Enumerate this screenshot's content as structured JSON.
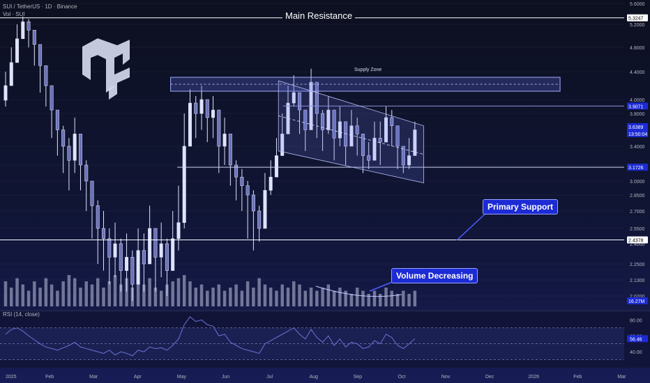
{
  "header": {
    "symbol_line": "SUI / TetherUS · 1D · Binance",
    "volume_line": "Vol · SUI",
    "rsi_title": "RSI (14, close)"
  },
  "annotations": {
    "main_resistance": "Main Resistance",
    "supply_zone": "Supply Zone",
    "primary_support": "Primary Support",
    "volume_decreasing": "Volume Decreasing"
  },
  "colors": {
    "candle": "#dfe3ff",
    "volume": "#bfc4dc",
    "rsi_line": "#6b74d6",
    "accent": "#1c2bd4",
    "level_line": "#ffffff"
  },
  "logo": {
    "icon": "tc-logo-icon"
  },
  "chart_data": [
    {
      "type": "candlestick",
      "title": "SUI / TetherUS · 1D · Binance",
      "y_ticks": [
        "5.6000",
        "5.2000",
        "4.8000",
        "4.4000",
        "4.0000",
        "3.8000",
        "3.4000",
        "3.2000",
        "3.0000",
        "2.8500",
        "2.7000",
        "2.5500",
        "2.4000",
        "2.2500",
        "2.1300",
        "2.0200"
      ],
      "x_ticks": [
        "2025",
        "Feb",
        "Mar",
        "Apr",
        "May",
        "Jun",
        "Jul",
        "Aug",
        "Sep",
        "Oct",
        "Nov",
        "Dec",
        "2026",
        "Feb",
        "Mar"
      ],
      "ylim": [
        2.0,
        5.6
      ],
      "price_labels": [
        {
          "value": "5.3247",
          "price": 5.3247,
          "style": "white"
        },
        {
          "value": "3.9071",
          "price": 3.9071,
          "style": "accent"
        },
        {
          "value": "3.6389",
          "price": 3.6389,
          "style": "accent",
          "sub": "13:50:04"
        },
        {
          "value": "3.1726",
          "price": 3.1726,
          "style": "accent"
        },
        {
          "value": "2.4378",
          "price": 2.4378,
          "style": "white"
        },
        {
          "value": "16.27M",
          "price": 2.0,
          "style": "accent"
        }
      ],
      "levels": {
        "main_resistance": 5.3247,
        "resistance": 3.9071,
        "support": 3.1726,
        "primary_support": 2.4378
      },
      "supply_zone": {
        "low": 4.12,
        "high": 4.32
      },
      "channel": {
        "start_month": 6.2,
        "end_month": 9.5,
        "upper": [
          4.27,
          3.65
        ],
        "lower": [
          3.35,
          2.98
        ]
      },
      "closes": [
        4.2,
        4.55,
        4.95,
        5.25,
        5.1,
        4.85,
        4.5,
        4.2,
        3.85,
        3.6,
        3.4,
        3.25,
        3.55,
        3.2,
        3.0,
        2.75,
        2.55,
        2.45,
        2.3,
        2.4,
        2.2,
        2.3,
        2.1,
        2.35,
        2.25,
        2.55,
        2.3,
        2.4,
        2.2,
        2.45,
        2.6,
        3.4,
        3.95,
        3.8,
        4.0,
        3.75,
        3.85,
        3.4,
        3.55,
        3.2,
        3.05,
        2.95,
        2.85,
        2.7,
        2.55,
        2.9,
        3.05,
        3.3,
        3.55,
        3.95,
        4.1,
        3.85,
        3.6,
        4.25,
        3.8,
        3.6,
        3.85,
        3.5,
        3.7,
        3.4,
        3.65,
        3.55,
        3.3,
        3.25,
        3.5,
        3.45,
        3.75,
        3.65,
        3.4,
        3.2,
        3.3,
        3.6
      ],
      "lows": [
        3.9,
        4.3,
        4.7,
        5.0,
        4.8,
        4.5,
        4.1,
        3.9,
        3.5,
        3.3,
        3.1,
        2.9,
        3.1,
        2.9,
        2.7,
        2.45,
        2.25,
        2.2,
        2.1,
        2.15,
        2.05,
        2.05,
        2.0,
        2.1,
        2.05,
        2.3,
        2.05,
        2.15,
        2.02,
        2.2,
        2.35,
        2.55,
        3.6,
        3.5,
        3.6,
        3.45,
        3.5,
        3.1,
        3.2,
        2.95,
        2.8,
        2.7,
        2.45,
        2.35,
        2.42,
        2.7,
        2.85,
        3.05,
        3.4,
        3.75,
        3.9,
        3.55,
        3.35,
        3.9,
        3.5,
        3.35,
        3.55,
        3.25,
        3.4,
        3.2,
        3.4,
        3.3,
        3.1,
        3.15,
        3.3,
        3.2,
        3.5,
        3.4,
        3.15,
        3.1,
        3.15,
        3.35
      ],
      "highs": [
        4.4,
        4.8,
        5.2,
        5.35,
        5.3,
        5.1,
        4.8,
        4.45,
        4.1,
        3.85,
        3.65,
        3.5,
        3.75,
        3.4,
        3.25,
        3.0,
        2.8,
        2.7,
        2.55,
        2.6,
        2.45,
        2.5,
        2.35,
        2.55,
        2.5,
        2.75,
        2.55,
        2.6,
        2.45,
        2.7,
        2.95,
        3.8,
        4.15,
        4.05,
        4.2,
        3.95,
        4.05,
        3.65,
        3.75,
        3.45,
        3.25,
        3.15,
        3.0,
        2.9,
        2.75,
        3.1,
        3.25,
        3.5,
        3.8,
        4.2,
        4.35,
        4.05,
        3.85,
        4.45,
        4.1,
        3.85,
        4.05,
        3.75,
        3.9,
        3.65,
        3.85,
        3.75,
        3.55,
        3.45,
        3.7,
        3.7,
        3.9,
        3.85,
        3.65,
        3.4,
        3.5,
        3.7
      ]
    },
    {
      "type": "bar",
      "title": "Vol · SUI",
      "values": [
        0.8,
        0.6,
        0.9,
        0.7,
        0.5,
        0.8,
        0.6,
        0.9,
        0.7,
        0.5,
        0.8,
        1.0,
        0.9,
        0.6,
        0.8,
        0.7,
        0.9,
        0.6,
        0.8,
        1.0,
        0.7,
        0.9,
        0.6,
        0.8,
        0.7,
        0.9,
        0.6,
        0.5,
        0.7,
        0.8,
        0.9,
        1.0,
        0.8,
        0.6,
        0.7,
        0.5,
        0.6,
        0.7,
        0.5,
        0.6,
        0.7,
        0.5,
        0.8,
        0.6,
        0.9,
        0.7,
        0.6,
        0.5,
        0.7,
        0.6,
        0.8,
        0.7,
        0.5,
        0.6,
        0.5,
        0.6,
        0.7,
        0.5,
        0.6,
        0.5,
        0.4,
        0.6,
        0.5,
        0.4,
        0.5,
        0.4,
        0.6,
        0.5,
        0.4,
        0.5,
        0.4,
        0.5
      ]
    },
    {
      "type": "line",
      "title": "RSI (14, close)",
      "y_ticks": [
        "80.00",
        "60.00",
        "40.00"
      ],
      "ylim": [
        20,
        90
      ],
      "current": "56.46",
      "values": [
        62,
        68,
        70,
        66,
        60,
        55,
        50,
        46,
        44,
        42,
        45,
        48,
        52,
        46,
        44,
        42,
        40,
        38,
        42,
        36,
        40,
        38,
        35,
        42,
        40,
        46,
        44,
        45,
        42,
        48,
        56,
        74,
        84,
        78,
        80,
        74,
        72,
        60,
        62,
        52,
        48,
        44,
        42,
        40,
        38,
        50,
        54,
        58,
        62,
        66,
        70,
        62,
        56,
        68,
        58,
        52,
        60,
        48,
        56,
        46,
        52,
        50,
        44,
        46,
        54,
        50,
        62,
        58,
        48,
        44,
        50,
        56.46
      ]
    }
  ]
}
